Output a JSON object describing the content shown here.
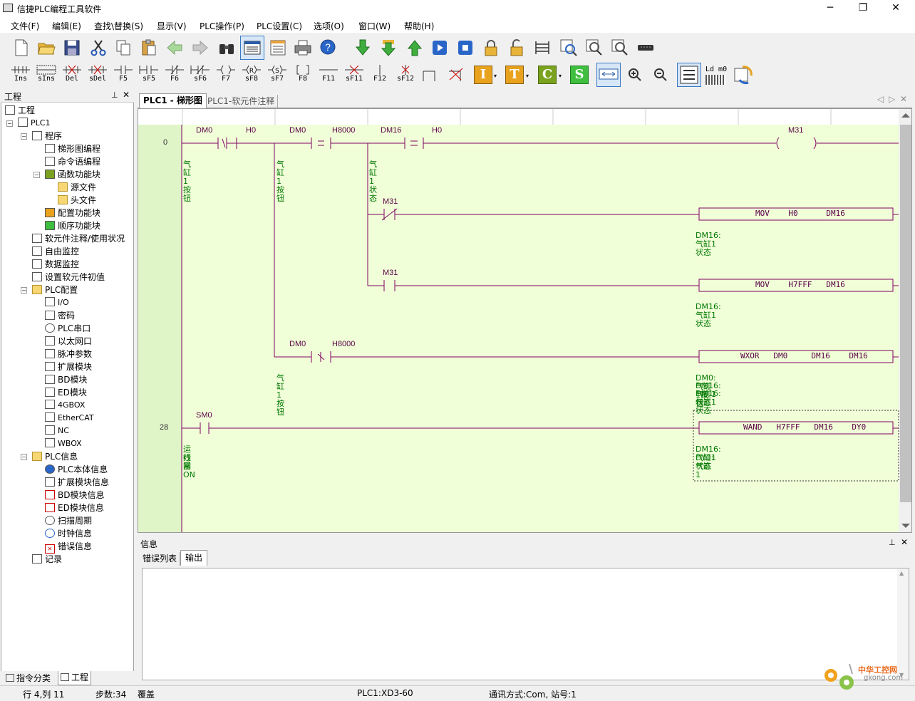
{
  "window": {
    "title": "信捷PLC编程工具软件",
    "controls": [
      "─",
      "❐",
      "✕"
    ]
  },
  "menu": [
    "文件(F)",
    "编辑(E)",
    "查找\\替换(S)",
    "显示(V)",
    "PLC操作(P)",
    "PLC设置(C)",
    "选项(O)",
    "窗口(W)",
    "帮助(H)"
  ],
  "function_toolbar": [
    "Ins",
    "sIns",
    "Del",
    "sDel",
    "F5",
    "sF5",
    "F6",
    "sF6",
    "F7",
    "sF8",
    "sF7",
    "F8",
    "F11",
    "sF11",
    "F12",
    "sF12"
  ],
  "function_toolbar_right": {
    "ld_label": "Ld m0"
  },
  "project_panel": {
    "title": "工程",
    "items": [
      {
        "label": "工程"
      },
      {
        "label": "PLC1"
      },
      {
        "label": "程序"
      },
      {
        "label": "梯形图编程"
      },
      {
        "label": "命令语编程"
      },
      {
        "label": "函数功能块"
      },
      {
        "label": "源文件"
      },
      {
        "label": "头文件"
      },
      {
        "label": "配置功能块"
      },
      {
        "label": "顺序功能块"
      },
      {
        "label": "软元件注释/使用状况"
      },
      {
        "label": "自由监控"
      },
      {
        "label": "数据监控"
      },
      {
        "label": "设置软元件初值"
      },
      {
        "label": "PLC配置"
      },
      {
        "label": "I/O"
      },
      {
        "label": "密码"
      },
      {
        "label": "PLC串口"
      },
      {
        "label": "以太网口"
      },
      {
        "label": "脉冲参数"
      },
      {
        "label": "扩展模块"
      },
      {
        "label": "BD模块"
      },
      {
        "label": "ED模块"
      },
      {
        "label": "4GBOX"
      },
      {
        "label": "EtherCAT"
      },
      {
        "label": "NC"
      },
      {
        "label": "WBOX"
      },
      {
        "label": "PLC信息"
      },
      {
        "label": "PLC本体信息"
      },
      {
        "label": "扩展模块信息"
      },
      {
        "label": "BD模块信息"
      },
      {
        "label": "ED模块信息"
      },
      {
        "label": "扫描周期"
      },
      {
        "label": "时钟信息"
      },
      {
        "label": "错误信息"
      },
      {
        "label": "记录"
      }
    ],
    "bottom_tabs": [
      "指令分类",
      "工程"
    ]
  },
  "doc_tabs": [
    "PLC1 - 梯形图",
    "PLC1-软元件注释"
  ],
  "ladder": {
    "step_numbers": [
      "0",
      "28"
    ],
    "contacts": {
      "c1": "DM0",
      "c2": "H0",
      "c3": "DM0",
      "c4": "H8000",
      "c5": "DM16",
      "c6": "H0",
      "coil": "M31",
      "c7": "M31",
      "c8": "M31",
      "c9": "DM0",
      "c10": "H8000",
      "c11": "SM0"
    },
    "comments": {
      "a1": "气缸1按钮",
      "a2": "气缸1按钮",
      "a3": "气缸1状态",
      "a4": "气缸1按钮",
      "b1": "DM16:气缸1状态",
      "b2": "DM16:气缸1状态",
      "b3": "DM0:气缸1按钮",
      "b4": "DM16:气缸1状态",
      "b5": "DM16:气缸1状态",
      "b6": "DM16:气缸1状态",
      "b7": "DY0:气缸1",
      "sm1": "运行常ON",
      "sm2": "线圈"
    },
    "instructions": [
      "MOV    H0      DM16",
      "MOV    H7FFF   DM16",
      "WXOR   DM0     DM16    DM16",
      "WAND   H7FFF   DM16    DY0"
    ]
  },
  "info_panel": {
    "title": "信息",
    "tabs": [
      "错误列表",
      "输出"
    ]
  },
  "status": {
    "pos": "行 4,列 11",
    "steps": "步数:34",
    "mode": "覆盖",
    "plc": "PLC1:XD3-60",
    "comm": "通讯方式:Com,  站号:1"
  },
  "watermark": {
    "text1": "中华工控网",
    "text2": "gkong.com"
  }
}
